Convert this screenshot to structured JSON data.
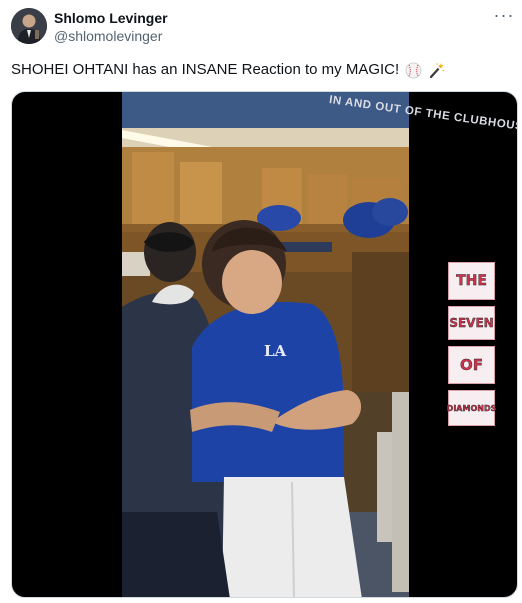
{
  "author": {
    "name": "Shlomo Levinger",
    "handle": "@shlomolevinger"
  },
  "tweet": {
    "text": "SHOHEI OHTANI has an INSANE Reaction to my MAGIC!",
    "emojis": [
      "baseball-icon",
      "magic-wand-icon"
    ]
  },
  "media": {
    "banner_text": "IN AND OUT OF THE CLUBHOUSE",
    "sign_words": [
      "THE",
      "SEVEN",
      "OF",
      "DIAMONDS"
    ]
  }
}
